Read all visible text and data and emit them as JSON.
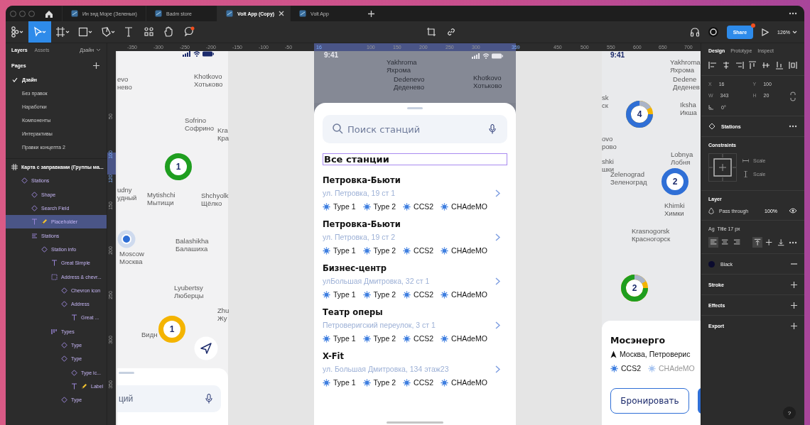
{
  "window_tabs": [
    {
      "label": "Ин энд Море (Зеленых)",
      "selected": false
    },
    {
      "label": "Badm store",
      "selected": false
    },
    {
      "label": "Volt App (Copy)",
      "selected": true
    },
    {
      "label": "Volt App",
      "selected": false
    }
  ],
  "toolbar": {
    "tools": [
      {
        "kind": "menu",
        "selected": false
      },
      {
        "kind": "move",
        "selected": true
      },
      {
        "kind": "frame",
        "selected": false
      },
      {
        "kind": "shape",
        "selected": false
      },
      {
        "kind": "pen",
        "selected": false
      },
      {
        "kind": "text",
        "selected": false
      },
      {
        "kind": "resources",
        "selected": false
      },
      {
        "kind": "hand",
        "selected": false
      },
      {
        "kind": "comment",
        "selected": false
      }
    ],
    "share": "Share",
    "zoom": "126%"
  },
  "layers_panel": {
    "tabs": [
      {
        "label": "Layers",
        "selected": true
      },
      {
        "label": "Assets",
        "selected": false
      }
    ],
    "page_menu": "Дзайн",
    "pages_title": "Pages",
    "pages": [
      {
        "label": "Дзайн",
        "selected": true
      },
      {
        "label": "Без правок",
        "selected": false
      },
      {
        "label": "Наработки",
        "selected": false
      },
      {
        "label": "Компоненты",
        "selected": false
      },
      {
        "label": "Интерактивы",
        "selected": false
      },
      {
        "label": "Правки концепта 2",
        "selected": false
      }
    ],
    "layers": [
      {
        "label": "Карта с заправками (Группы ма...",
        "kind": "frame",
        "selected": false,
        "children": [
          {
            "label": "Stations",
            "kind": "instance",
            "selected": false,
            "children": [
              {
                "label": "Shape",
                "kind": "instance",
                "selected": false
              },
              {
                "label": "Search Field",
                "kind": "instance",
                "selected": false
              },
              {
                "label": "Placeholder",
                "kind": "text",
                "selected": true,
                "marked": true
              },
              {
                "label": "Stations",
                "kind": "stack",
                "selected": false,
                "children": [
                  {
                    "label": "Station info",
                    "kind": "instance",
                    "selected": false,
                    "children": [
                      {
                        "label": "Great Simple",
                        "kind": "text",
                        "selected": false
                      },
                      {
                        "label": "Address & chevr...",
                        "kind": "group",
                        "selected": false,
                        "children": [
                          {
                            "label": "Chevron icon",
                            "kind": "instance",
                            "selected": false
                          },
                          {
                            "label": "Address",
                            "kind": "instance",
                            "selected": false,
                            "children": [
                              {
                                "label": "Great ...",
                                "kind": "text",
                                "selected": false
                              }
                            ]
                          }
                        ]
                      },
                      {
                        "label": "Types",
                        "kind": "row",
                        "selected": false,
                        "children": [
                          {
                            "label": "Type",
                            "kind": "instance",
                            "selected": false
                          },
                          {
                            "label": "Type",
                            "kind": "instance",
                            "selected": false,
                            "children": [
                              {
                                "label": "Type ic...",
                                "kind": "instance",
                                "selected": false
                              },
                              {
                                "label": "Label",
                                "kind": "text",
                                "selected": false,
                                "marked": true
                              }
                            ]
                          },
                          {
                            "label": "Type",
                            "kind": "instance",
                            "selected": false
                          }
                        ]
                      }
                    ]
                  }
                ]
              }
            ]
          }
        ]
      }
    ]
  },
  "rulers": {
    "horizontal": [
      {
        "label": "-350",
        "highlighted": false
      },
      {
        "label": "-300",
        "highlighted": false
      },
      {
        "label": "-250",
        "highlighted": false
      },
      {
        "label": "-200",
        "highlighted": false
      },
      {
        "label": "-150",
        "highlighted": false
      },
      {
        "label": "-100",
        "highlighted": false
      },
      {
        "label": "-50",
        "highlighted": false
      },
      {
        "label": "16",
        "highlighted": true
      },
      {
        "label": "100",
        "highlighted": false
      },
      {
        "label": "150",
        "highlighted": false
      },
      {
        "label": "200",
        "highlighted": false
      },
      {
        "label": "250",
        "highlighted": false
      },
      {
        "label": "300",
        "highlighted": false
      },
      {
        "label": "359",
        "highlighted": true
      },
      {
        "label": "450",
        "highlighted": false
      },
      {
        "label": "500",
        "highlighted": false
      },
      {
        "label": "550",
        "highlighted": false
      },
      {
        "label": "600",
        "highlighted": false
      },
      {
        "label": "650",
        "highlighted": false
      },
      {
        "label": "700",
        "highlighted": false
      }
    ],
    "vertical": [
      {
        "label": "50",
        "highlighted": false
      },
      {
        "label": "100",
        "highlighted": true
      },
      {
        "label": "120",
        "highlighted": true
      },
      {
        "label": "150",
        "highlighted": false
      },
      {
        "label": "200",
        "highlighted": false
      },
      {
        "label": "250",
        "highlighted": false
      },
      {
        "label": "300",
        "highlighted": false
      },
      {
        "label": "350",
        "highlighted": false
      }
    ]
  },
  "left_frame": {
    "labels": [
      {
        "en": "evo",
        "ru": "нево"
      },
      {
        "en": "Khotkovo",
        "ru": "Хотьково"
      },
      {
        "en": "Sofrino",
        "ru": "Софрино"
      },
      {
        "en": "Kra",
        "ru": "Кра"
      },
      {
        "en": "udny",
        "ru": "удный"
      },
      {
        "en": "Mytishchi",
        "ru": "Мытищи"
      },
      {
        "en": "Shchyolk",
        "ru": "Щёлко"
      },
      {
        "en": "Balashikha",
        "ru": "Балашиха"
      },
      {
        "en": "Moscow",
        "ru": "Москва"
      },
      {
        "en": "Lyubertsy",
        "ru": "Люберцы"
      },
      {
        "en": "Zhu",
        "ru": "Жу"
      },
      {
        "ru": "Видн"
      }
    ],
    "clusters": [
      {
        "count": "1",
        "kind": "ring",
        "color": "#1f9e1f"
      },
      {
        "count": "1",
        "kind": "ring",
        "color": "#f4b400"
      }
    ],
    "search_text": "ций"
  },
  "phone": {
    "time": "9:41",
    "labels": [
      {
        "en": "Yakhroma",
        "ru": "Яхрома"
      },
      {
        "en": "Dedenevo",
        "ru": "Деденево"
      },
      {
        "en": "Khotkovo",
        "ru": "Хотьково"
      }
    ],
    "search_placeholder": "Поиск станций",
    "section_title": {
      "text": "Все станции",
      "selected": true
    },
    "stations": [
      {
        "name": "Петровка-Бьюти",
        "address": "ул. Петровка, 19 ст 1",
        "types": [
          "Type 1",
          "Type 2",
          "CCS2",
          "CHAdeMO"
        ]
      },
      {
        "name": "Петровка-Бьюти",
        "address": "ул. Петровка, 19 ст 2",
        "types": [
          "Type 1",
          "Type 2",
          "CCS2",
          "CHAdeMO"
        ]
      },
      {
        "name": "Бизнес-центр",
        "address": "улБольшая Дмитровка, 32 ст 1",
        "types": [
          "Type 1",
          "Type 2",
          "CCS2",
          "CHAdeMO"
        ]
      },
      {
        "name": "Театр оперы",
        "address": "Петроверигский переулок, 3 ст 1",
        "types": [
          "Type 1",
          "Type 2",
          "CCS2",
          "CHAdeMO"
        ]
      },
      {
        "name": "X-Fit",
        "address": "ул. Большая Дмитровка, 134 этаж23",
        "types": [
          "Type 1",
          "Type 2",
          "CCS2",
          "CHAdeMO"
        ]
      }
    ]
  },
  "right_frame": {
    "time": "9:41",
    "labels": [
      {
        "en": "Yakhroma",
        "ru": "Яхрома"
      },
      {
        "en": "Dedene",
        "ru": "Деденев"
      },
      {
        "en": "sk",
        "ru": "ск"
      },
      {
        "en": "Iksha",
        "ru": "Икша"
      },
      {
        "en": "ovo",
        "ru": "рово"
      },
      {
        "en": "shki",
        "ru": "шки"
      },
      {
        "en": "Lobnya",
        "ru": "Лобня"
      },
      {
        "en": "Zelenograd",
        "ru": "Зеленоград"
      },
      {
        "en": "Khimki",
        "ru": "Химки"
      },
      {
        "en": "Krasnogorsk",
        "ru": "Красногорск"
      }
    ],
    "clusters": [
      {
        "count": "4",
        "kind": "split",
        "color": "#2f6fd6"
      },
      {
        "count": "2",
        "kind": "ring",
        "color": "#2f6fd6"
      },
      {
        "count": "2",
        "kind": "split",
        "color": "#1f9e1f"
      }
    ],
    "card": {
      "title": "Мосэнерго",
      "address": "Москва, Петроверис",
      "types": [
        {
          "label": "CCS2",
          "available": true
        },
        {
          "label": "CHAdeMO",
          "available": false
        }
      ],
      "button": "Бронировать"
    }
  },
  "design_panel": {
    "tabs": [
      {
        "label": "Design",
        "selected": true
      },
      {
        "label": "Prototype",
        "selected": false
      },
      {
        "label": "Inspect",
        "selected": false
      }
    ],
    "fields": [
      {
        "label": "X",
        "value": "16"
      },
      {
        "label": "Y",
        "value": "100"
      },
      {
        "label": "W",
        "value": "343"
      },
      {
        "label": "H",
        "value": "20"
      }
    ],
    "rotation": "0°",
    "component": "Stations",
    "constraints_title": "Constraints",
    "constraints": [
      "Scale",
      "Scale"
    ],
    "layer_title": "Layer",
    "blend": "Pass through",
    "opacity": "100%",
    "text_style_prefix": "Ag",
    "text_style": "Title 17 px",
    "text_align": [
      {
        "kind": "left",
        "selected": true
      },
      {
        "kind": "center",
        "selected": false
      },
      {
        "kind": "right",
        "selected": false
      }
    ],
    "vertical_align": [
      {
        "kind": "top",
        "selected": true
      },
      {
        "kind": "middle",
        "selected": false
      },
      {
        "kind": "bottom",
        "selected": false
      }
    ],
    "fill": {
      "name": "Black",
      "color": "#0b0b2e"
    },
    "sections": [
      "Stroke",
      "Effects",
      "Export"
    ],
    "help": "?"
  }
}
